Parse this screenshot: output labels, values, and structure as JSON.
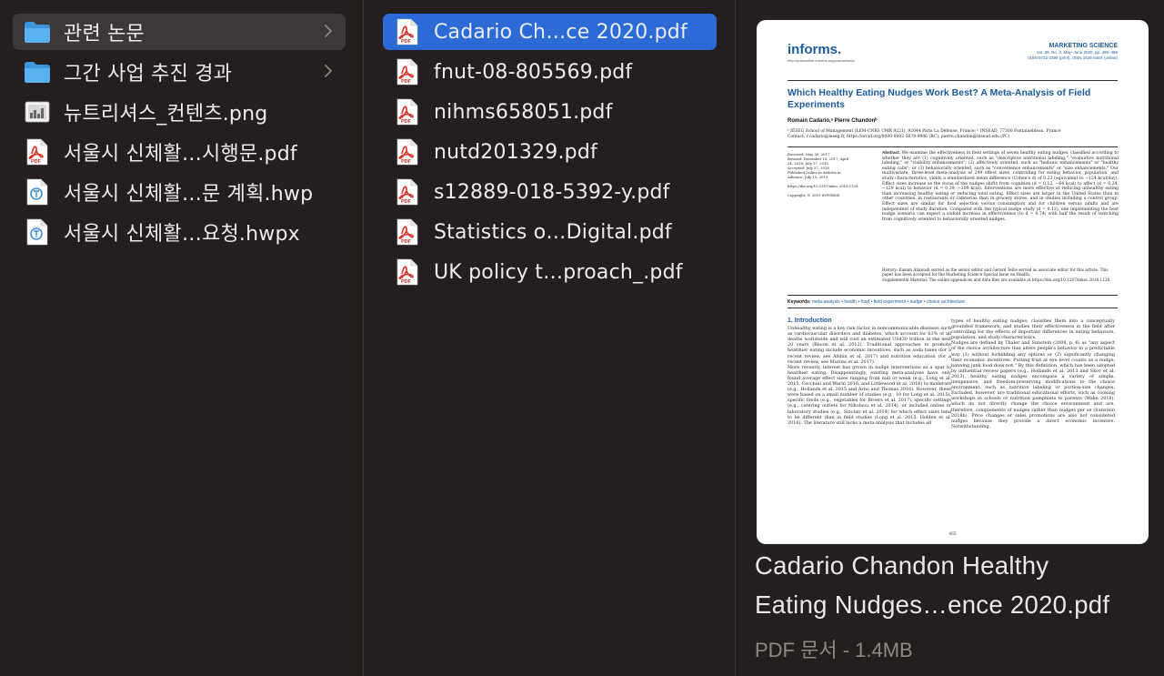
{
  "column1": {
    "items": [
      {
        "name": "관련 논문",
        "type": "folder",
        "selected": true
      },
      {
        "name": "그간 사업 추진 경과",
        "type": "folder",
        "selected": false
      },
      {
        "name": "뉴트리셔스_컨텐츠.png",
        "type": "image",
        "selected": false
      },
      {
        "name": "서울시 신체활…시행문.pdf",
        "type": "pdf",
        "selected": false
      },
      {
        "name": "서울시 신체활…문 계획.hwp",
        "type": "hwp",
        "selected": false
      },
      {
        "name": "서울시 신체활…요청.hwpx",
        "type": "hwp",
        "selected": false
      }
    ]
  },
  "column2": {
    "items": [
      {
        "name": "Cadario Ch…ce 2020.pdf",
        "type": "pdf",
        "selected": true
      },
      {
        "name": "fnut-08-805569.pdf",
        "type": "pdf",
        "selected": false
      },
      {
        "name": "nihms658051.pdf",
        "type": "pdf",
        "selected": false
      },
      {
        "name": "nutd201329.pdf",
        "type": "pdf",
        "selected": false
      },
      {
        "name": "s12889-018-5392-y.pdf",
        "type": "pdf",
        "selected": false
      },
      {
        "name": "Statistics o…Digital.pdf",
        "type": "pdf",
        "selected": false
      },
      {
        "name": "UK policy t…proach_.pdf",
        "type": "pdf",
        "selected": false
      }
    ]
  },
  "preview": {
    "file_name_line1": "Cadario Chandon Healthy",
    "file_name_line2": "Eating Nudges…ence 2020.pdf",
    "file_kind": "PDF 문서 - 1.4MB",
    "doc": {
      "logo": "informs.",
      "logo_url": "http://pubsonline.informs.org/journal/mksc",
      "journal": "MARKETING SCIENCE",
      "journal_info": "Vol. 39, No. 3, May–June 2020, pp. 465–486",
      "journal_issn": "ISSN 0732-2399 (print), ISSN 1526-548X (online)",
      "title": "Which Healthy Eating Nudges Work Best? A Meta-Analysis of Field Experiments",
      "authors": "Romain Cadario,ᵃ Pierre Chandonᵇ",
      "affiliation": "ᵃ IÉSEG School of Management (LEM-CNRS UMR 9221), 92044 Paris La Défense, France; ᵇ INSEAD, 77300 Fontainebleau, France",
      "contact": "Contact: r.cadario@ieseg.fr, https://orcid.org/0000-0002-5678-9906 (RC); pierre.chandon@insead.edu (PC)",
      "meta": "Received: May 30, 2017\nRevised: December 18, 2017; April 24, 2018; July 17, 2018\nAccepted: July 27, 2018\nPublished Online in Articles in Advance: July 15, 2019\n\nhttps://doi.org/10.1287/mksc.2018.1128\n\nCopyright: © 2019 INFORMS",
      "abstract_label": "Abstract.",
      "abstract": "We examine the effectiveness in field settings of seven healthy eating nudges, classified according to whether they are (1) cognitively oriented, such as \"descriptive nutritional labeling,\" \"evaluative nutritional labeling,\" or \"visibility enhancements\"; (2) affectively oriented, such as \"hedonic enhancements\" or \"healthy eating calls\"; or (3) behaviorally oriented, such as \"convenience enhancements\" or \"size enhancements.\" Our multivariate, three-level meta-analysis of 299 effect sizes, controlling for eating behavior, population, and study characteristics, yields a standardized mean difference (Cohen's d) of 0.23 (equivalent to −124 kcal/day). Effect sizes increase as the focus of the nudges shifts from cognition (d = 0.12, −64 kcal) to affect (d = 0.24, −129 kcal) to behavior (d = 0.39, −209 kcal). Interventions are more effective at reducing unhealthy eating than increasing healthy eating or reducing total eating. Effect sizes are larger in the United States than in other countries, in restaurants or cafeterias than in grocery stores, and in studies including a control group. Effect sizes are similar for food selection versus consumption and for children versus adults and are independent of study duration. Compared with the typical nudge study (d = 0.12), one implementing the best nudge scenario can expect a sixfold increase in effectiveness (to d = 0.74) with half the result of switching from cognitively oriented to behaviorally oriented nudges.",
      "history": "History: Kusum Ailawadi served as the senior editor and Gerard Tellis served as associate editor for this article. This paper has been accepted for the Marketing Science Special Issue on Health.\nSupplemental Material: The online appendices and data files are available at https://doi.org/10.1287/mksc.2018.1128.",
      "keywords_label": "Keywords:",
      "keywords": "meta-analysis • health • food • field experiment • nudge • choice architecture",
      "section_title": "1. Introduction",
      "col_left": "Unhealthy eating is a key risk factor in noncommunicable diseases such as cardiovascular disorders and diabetes, which account for 63% of all deaths worldwide and will cost an estimated US$30 trillion in the next 20 years (Bloom et al. 2012). Traditional approaches to promote healthier eating include economic incentives, such as soda taxes (for a recent review, see Afshin et al. 2017) and nutrition education (for a recent review, see Murimi et al. 2017).\n    More recently, interest has grown in nudge interventions as a spur to healthier eating. Disappointingly, existing meta-analyses have only found average effect sizes ranging from null or weak (e.g., Long et al. 2015, Cecchini and Warin 2016, and Littlewood et al. 2016) to moderate (e.g., Hollands et al. 2015 and Arno and Thomas 2016). However, these were based on a small number of studies (e.g., 19 for Long et al. 2015), specific foods (e.g., vegetables for Broers et al. 2017), specific settings (e.g., catering outlets for Nikolaou et al. 2014), or included online or laboratory studies (e.g., Sinclair et al. 2014) for which effect sizes tend to be different than in field studies (Long et al. 2015, Holden et al. 2016). The literature still lacks a meta-analysis that includes all",
      "col_right": "types of healthy eating nudges; classifies them into a conceptually grounded framework; and studies their effectiveness in the field after controlling for the effects of important differences in eating behaviors, population, and study characteristics.\n    Nudges are defined by Thaler and Sunstein (2008, p. 6) as \"any aspect of the choice architecture that alters people's behavior in a predictable way (1) without forbidding any options or (2) significantly changing their economic incentives. Putting fruit at eye level counts as a nudge; banning junk food does not.\" By this definition, which has been adopted by influential review papers (e.g., Hollands et al. 2013 and Skov et al. 2013), healthy eating nudges encompass a variety of simple, inexpensive, and freedom-preserving modifications to the choice environment, such as nutrition labeling or portion-size changes. Excluded, however, are traditional educational efforts, such as cooking workshops in schools or nutrition pamphlets to parents (Wake 2018), which do not directly change the choice environment and are, therefore, complements of nudges rather than nudges per se (Sunstein 2018b). Price changes or sales promotions are also not considered nudges because they provide a direct economic incentive. Notwithstanding,",
      "page_number": "465"
    }
  },
  "colors": {
    "selection_blue": "#2c6bd6",
    "selection_gray": "#3b3837",
    "pdf_red": "#d9332b",
    "folder_blue": "#4aa3e8"
  }
}
